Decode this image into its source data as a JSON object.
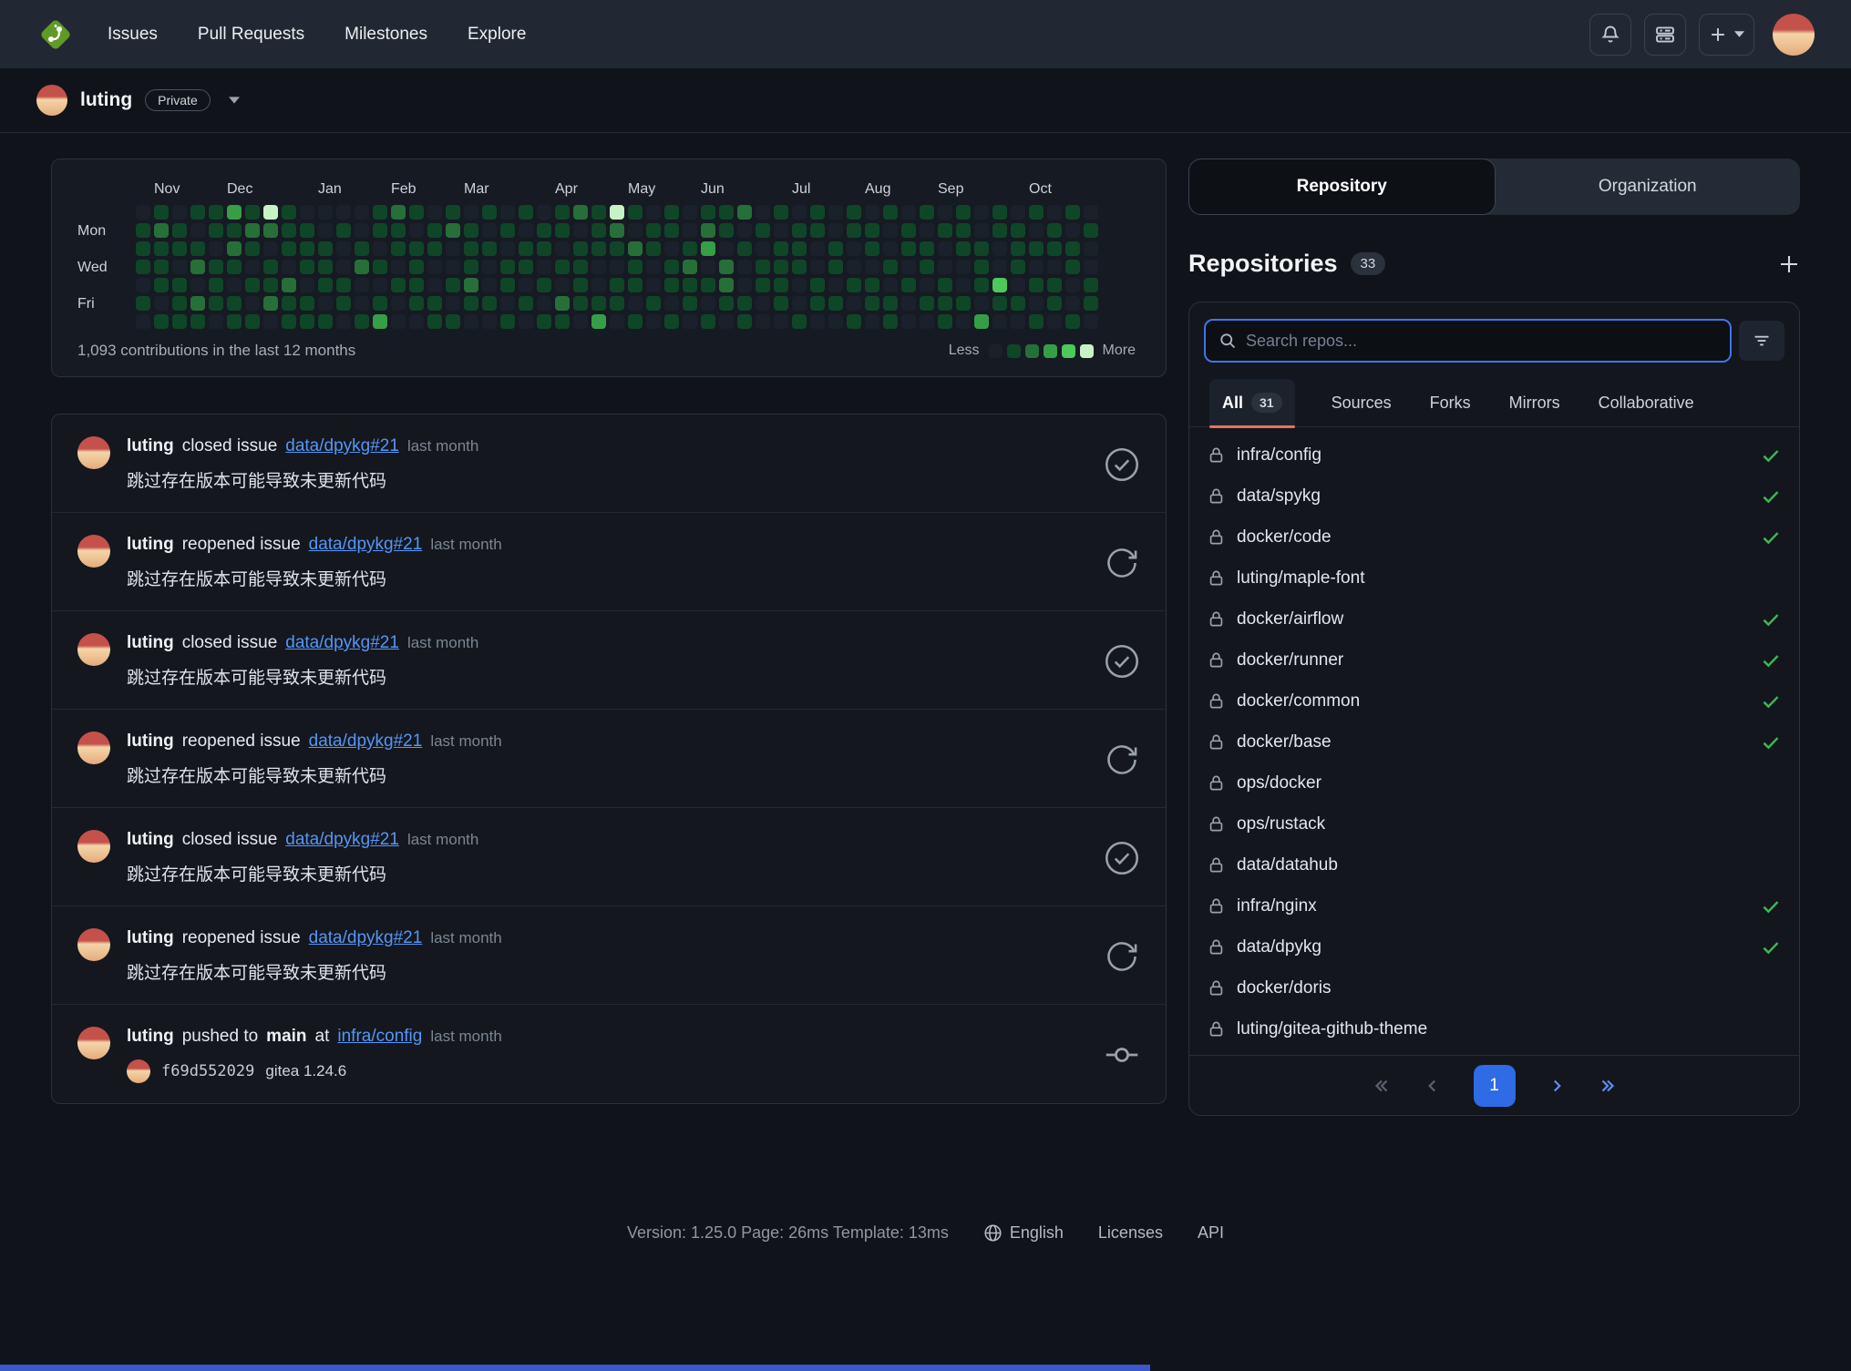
{
  "navbar": {
    "links": [
      {
        "label": "Issues"
      },
      {
        "label": "Pull Requests"
      },
      {
        "label": "Milestones"
      },
      {
        "label": "Explore"
      }
    ]
  },
  "context": {
    "username": "luting",
    "badge": "Private"
  },
  "heatmap": {
    "caption": "1,093 contributions in the last 12 months",
    "less": "Less",
    "more": "More",
    "months": [
      {
        "label": "Nov",
        "col": 1
      },
      {
        "label": "Dec",
        "col": 5
      },
      {
        "label": "Jan",
        "col": 10
      },
      {
        "label": "Feb",
        "col": 14
      },
      {
        "label": "Mar",
        "col": 18
      },
      {
        "label": "Apr",
        "col": 23
      },
      {
        "label": "May",
        "col": 27
      },
      {
        "label": "Jun",
        "col": 31
      },
      {
        "label": "Jul",
        "col": 36
      },
      {
        "label": "Aug",
        "col": 40
      },
      {
        "label": "Sep",
        "col": 44
      },
      {
        "label": "Oct",
        "col": 49
      }
    ],
    "day_labels": [
      {
        "row": 1,
        "label": "Mon"
      },
      {
        "row": 3,
        "label": "Wed"
      },
      {
        "row": 5,
        "label": "Fri"
      }
    ],
    "colors": [
      "#1b212b",
      "#0f4627",
      "#266f38",
      "#369e47",
      "#4cc95b",
      "#c8f2c6"
    ],
    "weeks": [
      "0111010",
      "1211101",
      "0110111",
      "1012021",
      "1101110",
      "3121011",
      "1210101",
      "5201120",
      "1110211",
      "0111011",
      "0011101",
      "0100110",
      "0012001",
      "1101013",
      "2110100",
      "1011110",
      "0110011",
      "1200101",
      "0111210",
      "1010010",
      "0101101",
      "1011010",
      "0110101",
      "1101021",
      "2011110",
      "1110013",
      "5210110",
      "1021101",
      "0110010",
      "1101101",
      "0012110",
      "1230101",
      "1102210",
      "2010011",
      "0101100",
      "1011110",
      "0111001",
      "1100110",
      "0011010",
      "1100101",
      "0110110",
      "1001011",
      "0110100",
      "1011010",
      "0100111",
      "1110010",
      "0011103",
      "1100410",
      "0111010",
      "1010101",
      "0110110",
      "1011001",
      "0100110"
    ]
  },
  "feed": {
    "items": [
      {
        "user": "luting",
        "action": "closed issue",
        "link": "data/dpykg#21",
        "time": "last month",
        "body": "跳过存在版本可能导致未更新代码",
        "icon": "check-circle"
      },
      {
        "user": "luting",
        "action": "reopened issue",
        "link": "data/dpykg#21",
        "time": "last month",
        "body": "跳过存在版本可能导致未更新代码",
        "icon": "refresh"
      },
      {
        "user": "luting",
        "action": "closed issue",
        "link": "data/dpykg#21",
        "time": "last month",
        "body": "跳过存在版本可能导致未更新代码",
        "icon": "check-circle"
      },
      {
        "user": "luting",
        "action": "reopened issue",
        "link": "data/dpykg#21",
        "time": "last month",
        "body": "跳过存在版本可能导致未更新代码",
        "icon": "refresh"
      },
      {
        "user": "luting",
        "action": "closed issue",
        "link": "data/dpykg#21",
        "time": "last month",
        "body": "跳过存在版本可能导致未更新代码",
        "icon": "check-circle"
      },
      {
        "user": "luting",
        "action": "reopened issue",
        "link": "data/dpykg#21",
        "time": "last month",
        "body": "跳过存在版本可能导致未更新代码",
        "icon": "refresh"
      },
      {
        "user": "luting",
        "action": "pushed to",
        "branch": "main",
        "preposition": "at",
        "link": "infra/config",
        "time": "last month",
        "commit": {
          "sha": "f69d552029",
          "message": "gitea 1.24.6"
        },
        "icon": "commit"
      }
    ]
  },
  "sidebar": {
    "tabs": [
      {
        "label": "Repository",
        "active": true
      },
      {
        "label": "Organization",
        "active": false
      }
    ],
    "heading": "Repositories",
    "count": "33",
    "search_placeholder": "Search repos...",
    "filters": [
      {
        "label": "All",
        "badge": "31",
        "active": true
      },
      {
        "label": "Sources"
      },
      {
        "label": "Forks"
      },
      {
        "label": "Mirrors"
      },
      {
        "label": "Collaborative"
      }
    ],
    "repos": [
      {
        "name": "infra/config",
        "private": true,
        "check": true
      },
      {
        "name": "data/spykg",
        "private": true,
        "check": true
      },
      {
        "name": "docker/code",
        "private": true,
        "check": true
      },
      {
        "name": "luting/maple-font",
        "private": true,
        "check": false
      },
      {
        "name": "docker/airflow",
        "private": true,
        "check": true
      },
      {
        "name": "docker/runner",
        "private": true,
        "check": true
      },
      {
        "name": "docker/common",
        "private": true,
        "check": true
      },
      {
        "name": "docker/base",
        "private": true,
        "check": true
      },
      {
        "name": "ops/docker",
        "private": true,
        "check": false
      },
      {
        "name": "ops/rustack",
        "private": true,
        "check": false
      },
      {
        "name": "data/datahub",
        "private": true,
        "check": false
      },
      {
        "name": "infra/nginx",
        "private": true,
        "check": true
      },
      {
        "name": "data/dpykg",
        "private": true,
        "check": true
      },
      {
        "name": "docker/doris",
        "private": true,
        "check": false
      },
      {
        "name": "luting/gitea-github-theme",
        "private": true,
        "check": false
      }
    ],
    "pagination": {
      "current": "1"
    }
  },
  "footer": {
    "version": "Version: 1.25.0 Page: 26ms Template: 13ms",
    "links": [
      {
        "label": "English",
        "icon": "globe"
      },
      {
        "label": "Licenses"
      },
      {
        "label": "API"
      }
    ]
  },
  "colors": {
    "accent_underline": "#e8735a",
    "link_blue": "#5596f6",
    "check_green": "#3db656",
    "pagination_blue": "#2e6be5",
    "logo_green": "#609926"
  }
}
